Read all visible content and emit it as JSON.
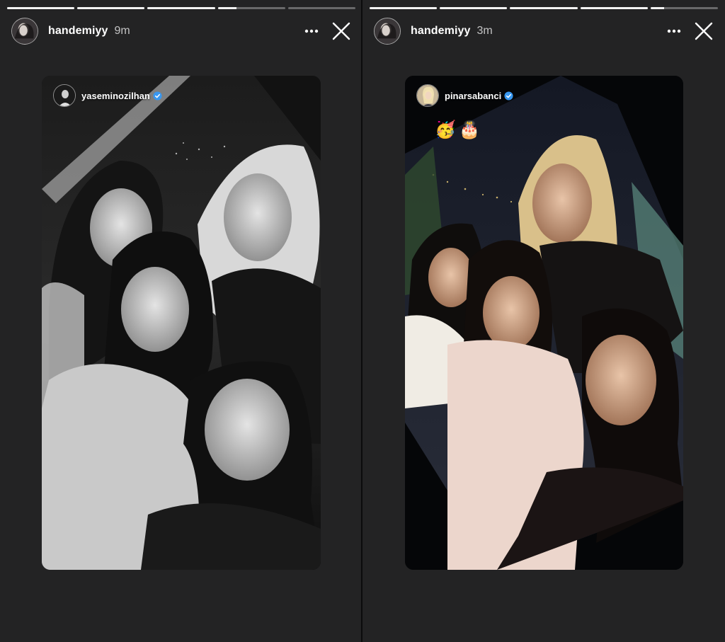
{
  "stories": [
    {
      "author": "handemiyy",
      "time": "9m",
      "progress": [
        1,
        1,
        1,
        0.28,
        0
      ],
      "mention": {
        "username": "yaseminozilhan",
        "verified": true
      },
      "photo_style": "black-and-white"
    },
    {
      "author": "handemiyy",
      "time": "3m",
      "progress": [
        1,
        1,
        1,
        1,
        0.2
      ],
      "mention": {
        "username": "pinarsabanci",
        "verified": true
      },
      "stickers": [
        "🥳",
        "🎂"
      ],
      "photo_style": "color"
    }
  ],
  "icons": {
    "more": "more-horizontal-icon",
    "close": "close-icon",
    "verified": "verified-badge-icon"
  },
  "colors": {
    "background": "#232324",
    "verified_blue": "#3897f0",
    "text": "#ffffff"
  }
}
